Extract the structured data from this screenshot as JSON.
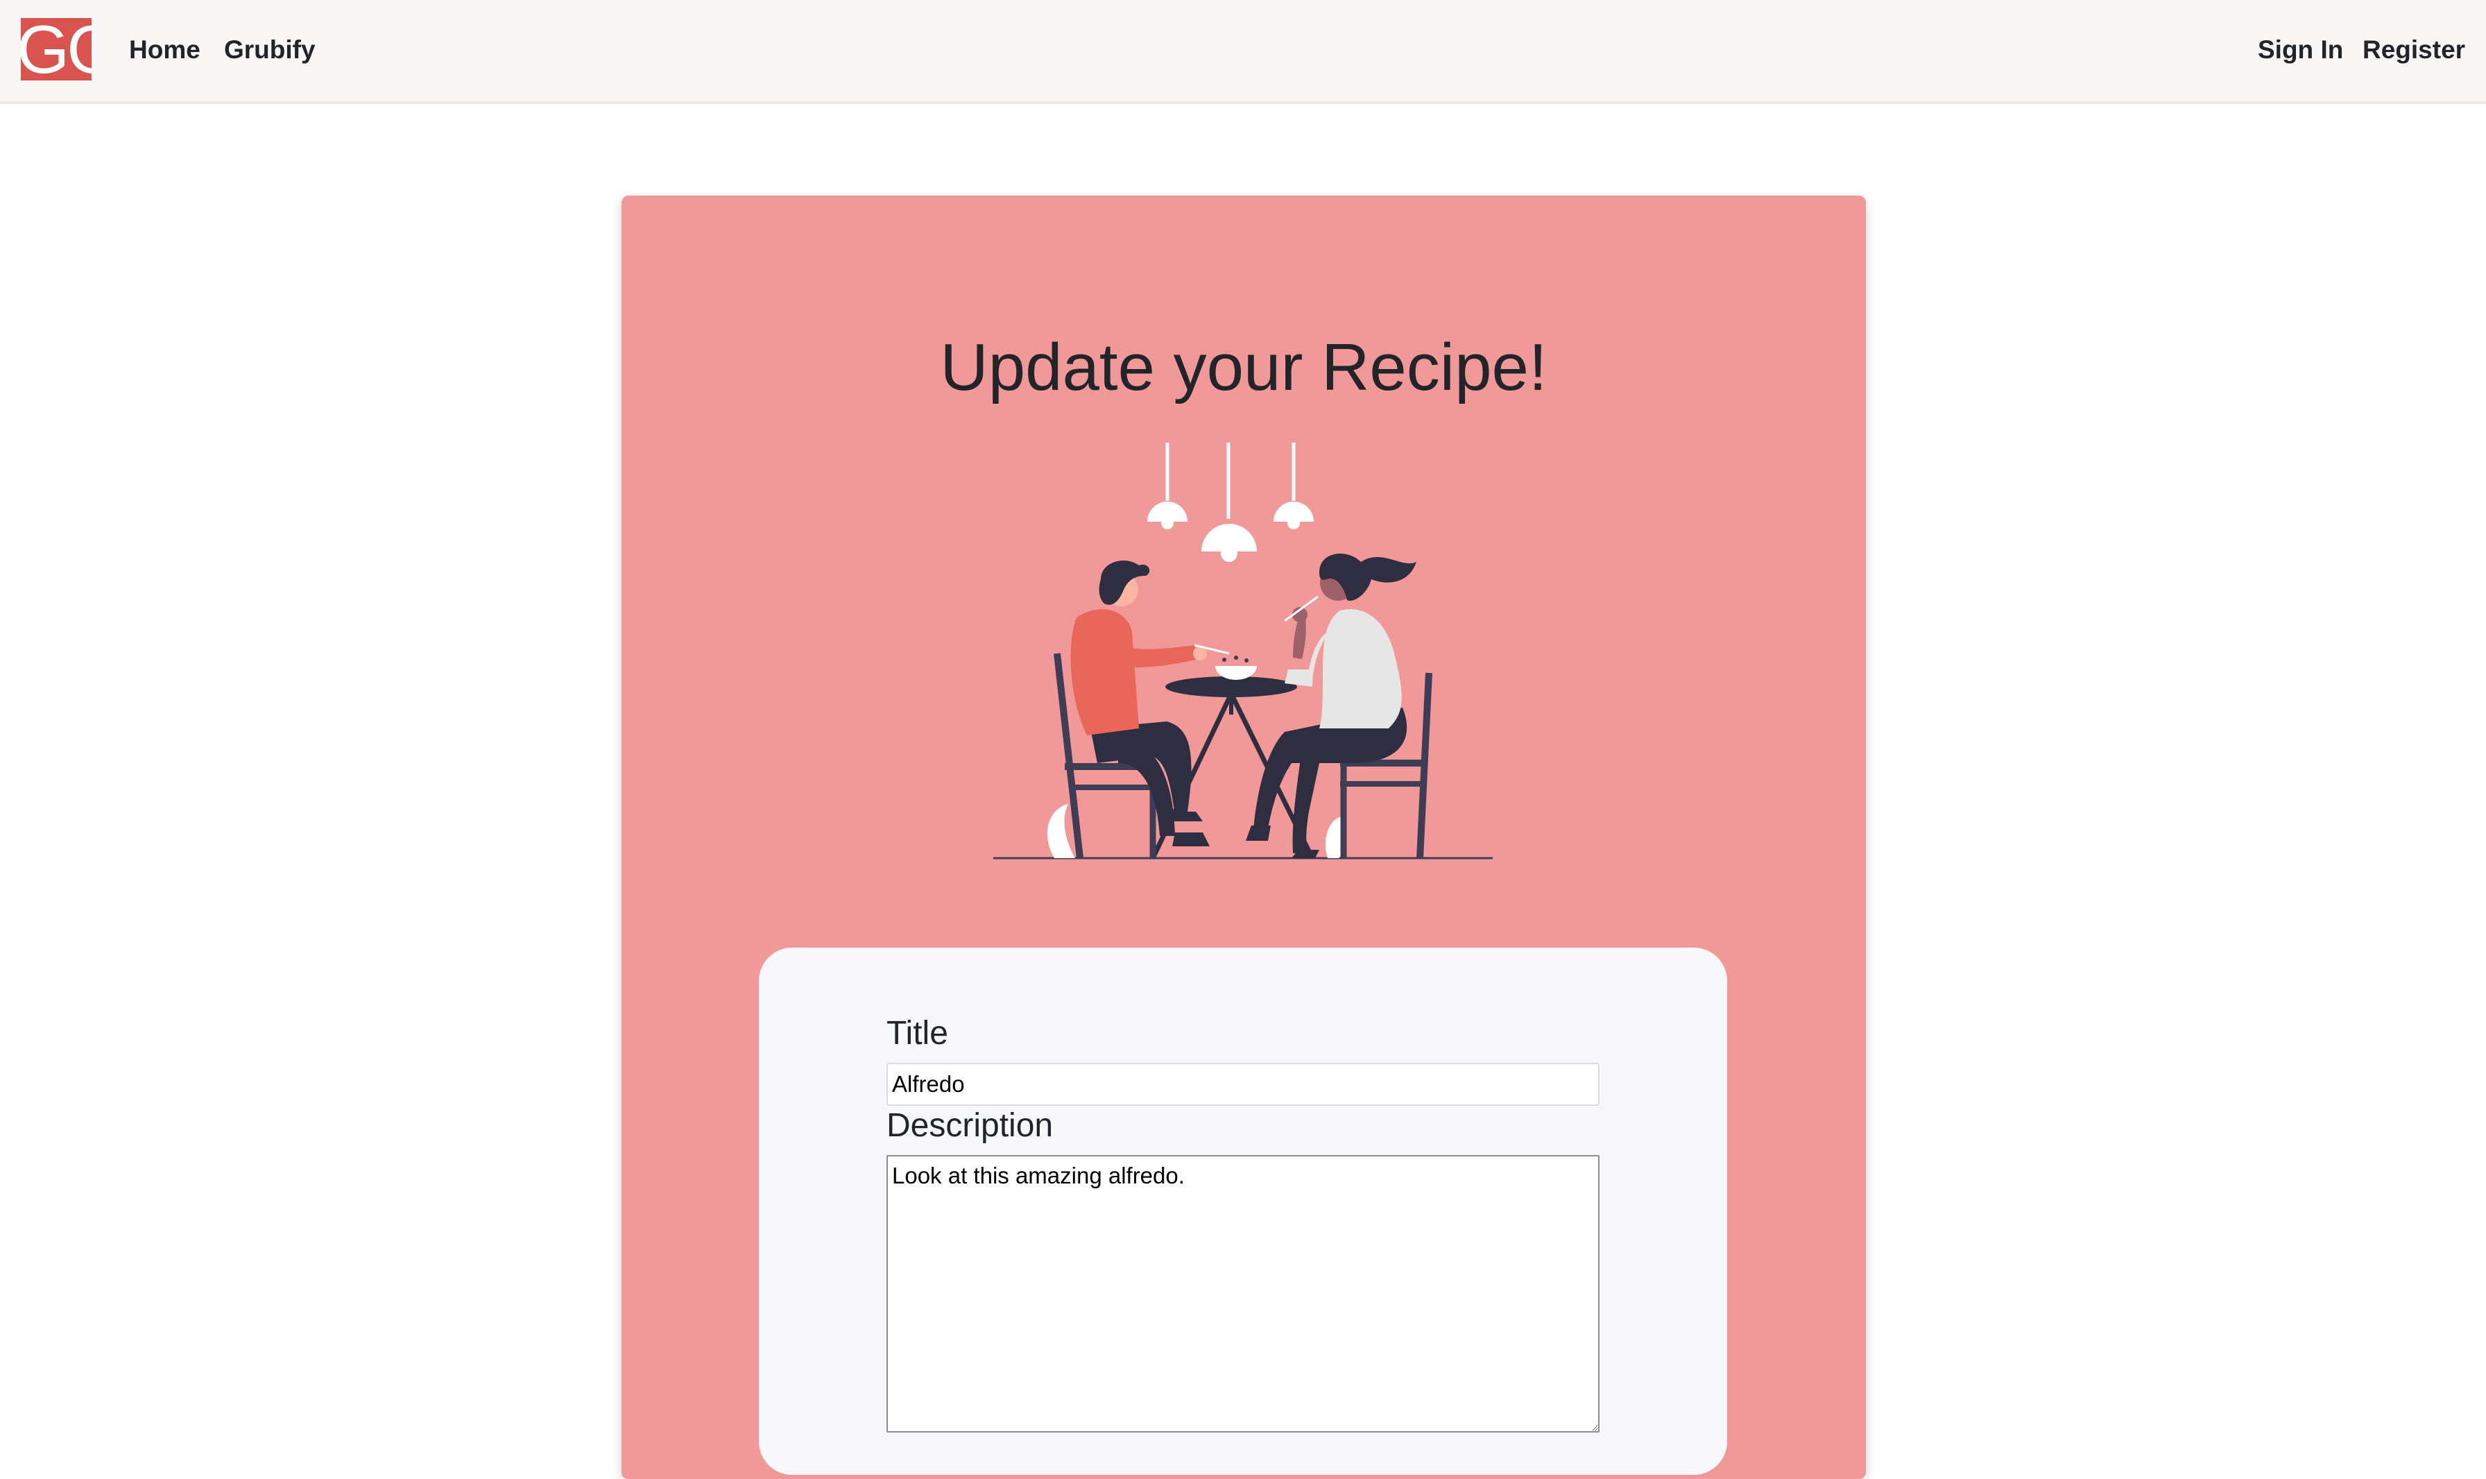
{
  "navbar": {
    "logo_text": "GG",
    "links": {
      "home": "Home",
      "grubify": "Grubify",
      "sign_in": "Sign In",
      "register": "Register"
    },
    "logo_color": "#d9534f"
  },
  "card": {
    "title": "Update your Recipe!",
    "background_color": "#f19999",
    "illustration": "people-dining-illustration"
  },
  "form": {
    "title_label": "Title",
    "title_value": "Alfredo",
    "description_label": "Description",
    "description_value": "Look at this amazing alfredo."
  }
}
